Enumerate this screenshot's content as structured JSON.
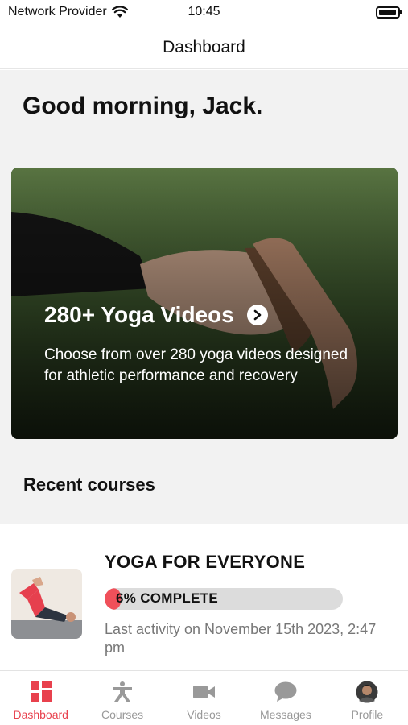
{
  "status_bar": {
    "carrier": "Network Provider",
    "time": "10:45",
    "icons": [
      "wifi-icon",
      "battery-icon"
    ]
  },
  "nav": {
    "title": "Dashboard"
  },
  "greeting": "Good morning, Jack.",
  "hero": {
    "title": "280+ Yoga Videos",
    "description": "Choose from over 280 yoga videos designed for athletic performance and recovery",
    "icon": "chevron-right-circle-icon"
  },
  "recent": {
    "section_title": "Recent courses",
    "courses": [
      {
        "title": "YOGA FOR EVERYONE",
        "progress_label": "6% COMPLETE",
        "progress_fraction": 0.06,
        "last_activity": "Last activity on November 15th 2023, 2:47 pm"
      }
    ]
  },
  "tabs": [
    {
      "label": "Dashboard",
      "icon": "dashboard-icon",
      "active": true
    },
    {
      "label": "Courses",
      "icon": "yoga-person-icon",
      "active": false
    },
    {
      "label": "Videos",
      "icon": "video-camera-icon",
      "active": false
    },
    {
      "label": "Messages",
      "icon": "chat-bubble-icon",
      "active": false
    },
    {
      "label": "Profile",
      "icon": "avatar-icon",
      "active": false
    }
  ],
  "colors": {
    "accent": "#e8414d",
    "progress_fill": "#f0505a",
    "progress_track": "#dcdcdc",
    "background": "#f2f2f2",
    "inactive_tab": "#999999"
  }
}
